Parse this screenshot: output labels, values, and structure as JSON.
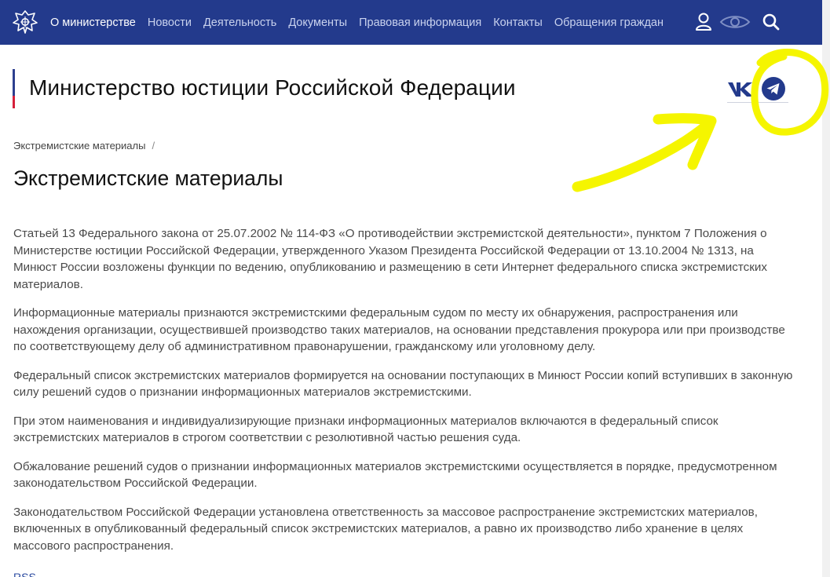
{
  "header": {
    "nav": [
      {
        "label": "О министерстве",
        "active": true
      },
      {
        "label": "Новости"
      },
      {
        "label": "Деятельность"
      },
      {
        "label": "Документы"
      },
      {
        "label": "Правовая информация"
      },
      {
        "label": "Контакты"
      },
      {
        "label": "Обращения граждан"
      }
    ],
    "icons": [
      "coat-of-arms-icon",
      "user-icon",
      "eye-icon",
      "search-icon"
    ],
    "bg_color": "#233a8c"
  },
  "site_title": "Министерство юстиции Российской Федерации",
  "social": {
    "vk_icon": "vk-icon",
    "telegram_icon": "telegram-icon",
    "accent": "#233a8c"
  },
  "breadcrumb": {
    "item": "Экстремистские материалы",
    "separator": "/"
  },
  "page_title": "Экстремистские материалы",
  "paragraphs": [
    "Статьей 13 Федерального закона от 25.07.2002 № 114-ФЗ «О противодействии экстремистской деятельности», пунктом 7 Положения о Министерстве юстиции Российской Федерации, утвержденного Указом Президента Российской Федерации от 13.10.2004 № 1313, на Минюст России возложены функции по ведению, опубликованию и размещению в сети Интернет федерального списка экстремистских материалов.",
    "Информационные материалы признаются экстремистскими федеральным судом по месту их обнаружения, распространения или нахождения организации, осуществившей производство таких материалов, на основании представления прокурора или при производстве по соответствующему делу об административном правонарушении, гражданскому или уголовному делу.",
    "Федеральный список экстремистских материалов формируется на основании поступающих в Минюст России копий вступивших в законную силу решений судов о признании информационных материалов экстремистскими.",
    "При этом наименования и индивидуализирующие признаки информационных материалов включаются в федеральный список экстремистских материалов в строгом соответствии с резолютивной частью решения суда.",
    "Обжалование решений судов о признании информационных материалов экстремистскими осуществляется в порядке, предусмотренном законодательством Российской Федерации.",
    "Законодательством Российской Федерации установлена ответственность за массовое распространение экстремистских материалов, включенных в опубликованный федеральный список экстремистских материалов, а равно их производство либо хранение в целях массового распространения."
  ],
  "more_link": "RSS",
  "annotation": {
    "color": "#f5f500",
    "shapes": [
      "circle-annotation",
      "arrow-annotation"
    ]
  }
}
